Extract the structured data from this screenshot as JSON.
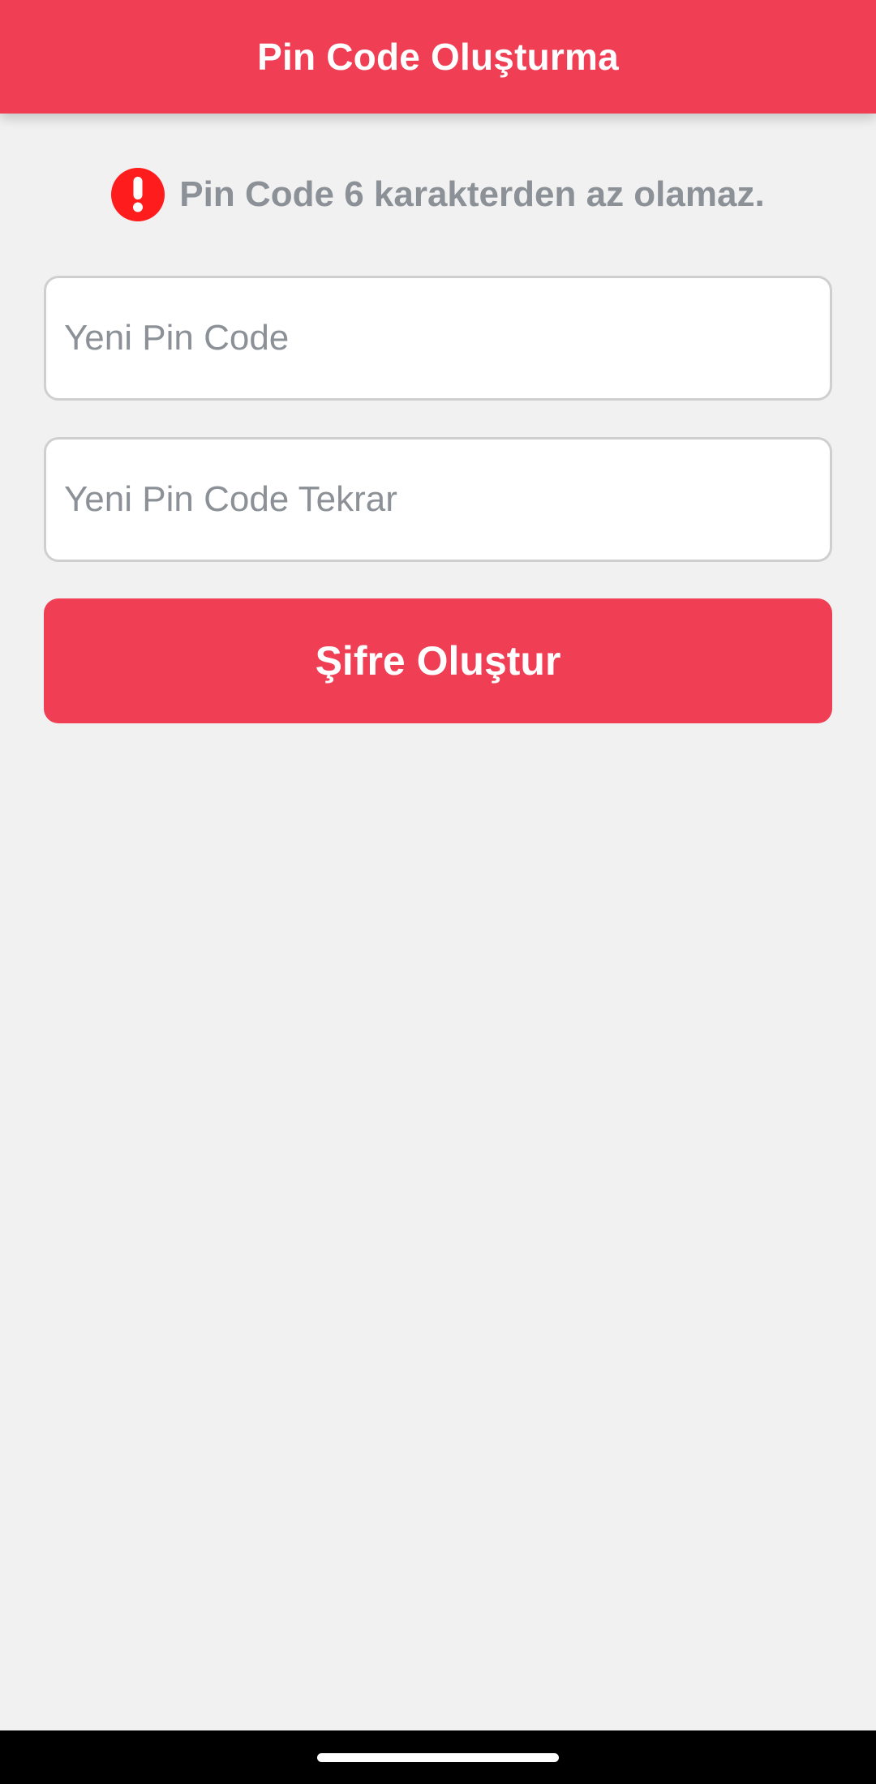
{
  "app_bar": {
    "title": "Pin Code Oluşturma",
    "color": "#f03e55"
  },
  "notice": {
    "icon": "exclamation-circle-icon",
    "icon_color": "#ff1c1c",
    "message": "Pin Code 6 karakterden az olamaz."
  },
  "form": {
    "new_pin": {
      "value": "",
      "placeholder": "Yeni Pin Code"
    },
    "new_pin_repeat": {
      "value": "",
      "placeholder": "Yeni Pin Code Tekrar"
    },
    "submit_label": "Şifre Oluştur"
  }
}
